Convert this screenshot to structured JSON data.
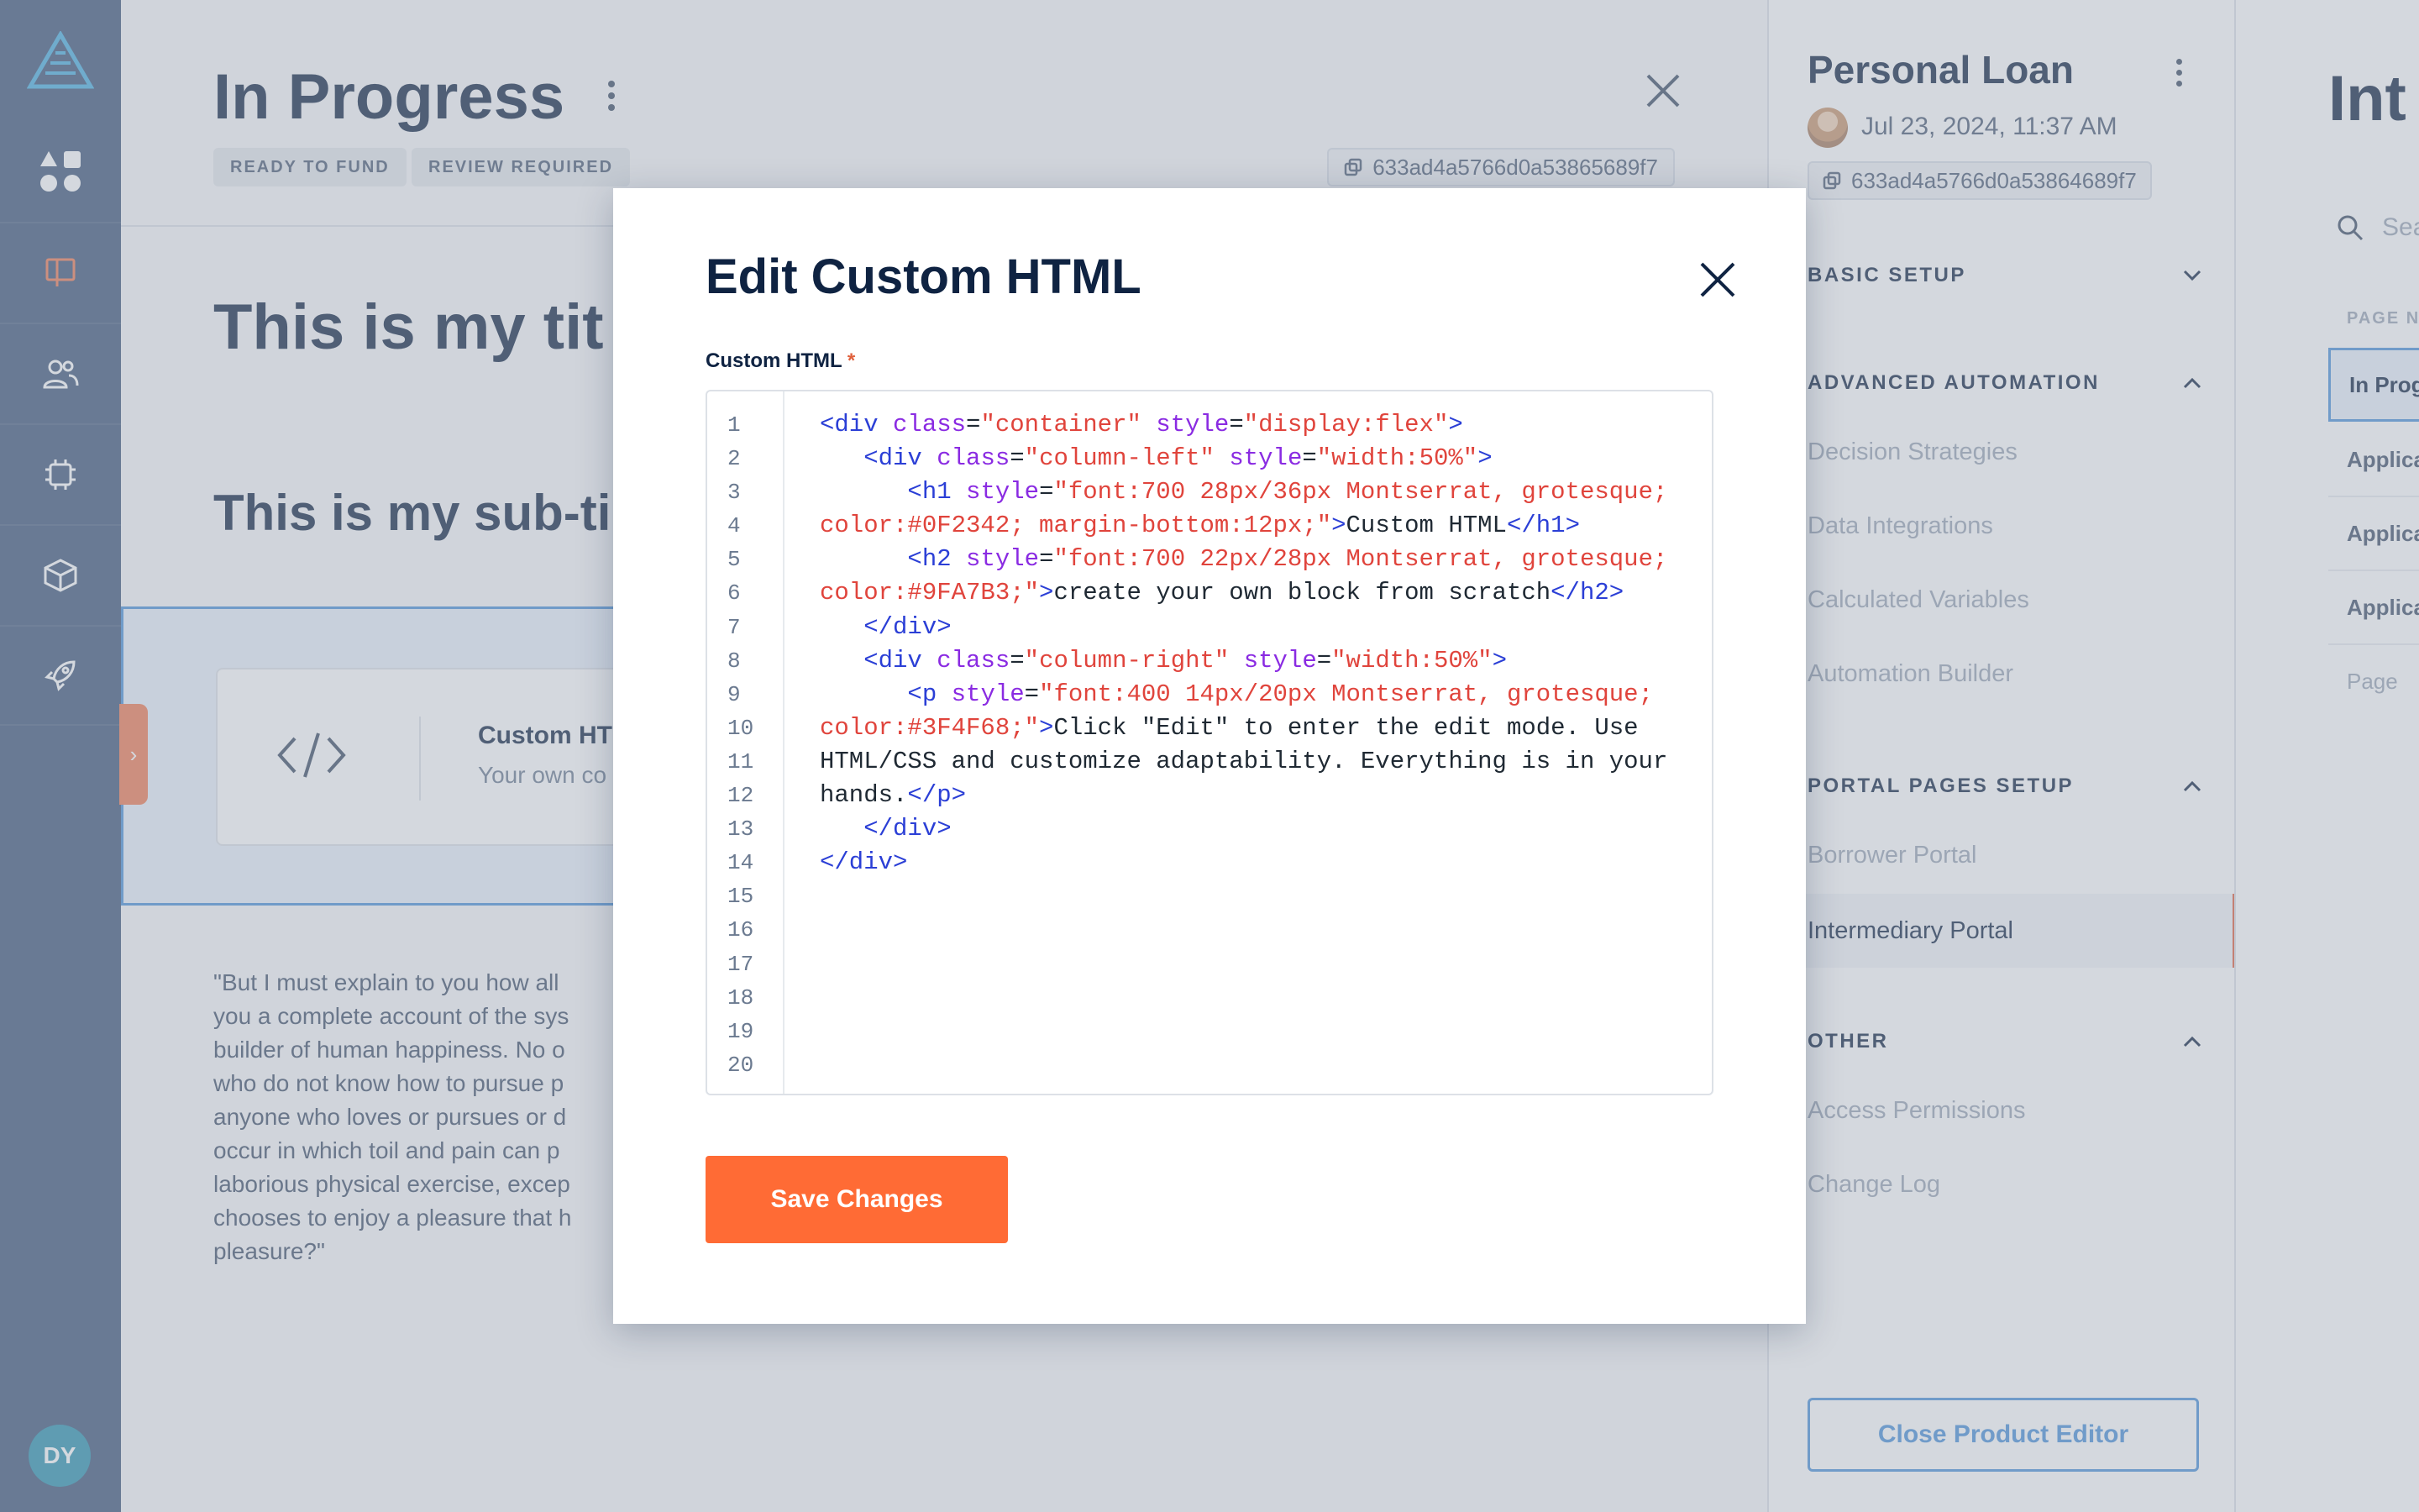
{
  "rail": {
    "avatar_initials": "DY",
    "active_color": "#f07a52"
  },
  "main": {
    "title": "In Progress",
    "tags": [
      "READY TO FUND",
      "REVIEW REQUIRED"
    ],
    "record_id": "633ad4a5766d0a53865689f7",
    "heading_1": "This is my tit",
    "heading_2": "This is my sub-ti",
    "block": {
      "title": "Custom HT",
      "description": "Your own co"
    },
    "paragraph_lines": [
      "\"But I must explain to you how all",
      "you a complete account of the sys",
      "builder of human happiness. No o",
      "who do not know how to pursue p",
      "anyone who loves or pursues or d",
      "occur in which toil and pain can p",
      "laborious physical exercise, excep",
      "chooses to enjoy a pleasure that h",
      "pleasure?\""
    ]
  },
  "sidebar": {
    "title": "Personal Loan",
    "date": "Jul 23, 2024, 11:37 AM",
    "product_id": "633ad4a5766d0a53864689f7",
    "sections": [
      {
        "label": "BASIC SETUP",
        "expanded": false,
        "items": []
      },
      {
        "label": "ADVANCED AUTOMATION",
        "expanded": true,
        "items": [
          "Decision Strategies",
          "Data Integrations",
          "Calculated Variables",
          "Automation Builder"
        ]
      },
      {
        "label": "PORTAL PAGES SETUP",
        "expanded": true,
        "items": [
          "Borrower Portal",
          "Intermediary Portal"
        ]
      },
      {
        "label": "OTHER",
        "expanded": true,
        "items": [
          "Access Permissions",
          "Change Log"
        ]
      }
    ],
    "active_item": "Intermediary Portal",
    "close_button": "Close Product Editor"
  },
  "far_panel": {
    "title": "Int",
    "search_placeholder": "Sea",
    "column_header": "PAGE NA",
    "rows": [
      "In Prog",
      "Applica",
      "Applica",
      "Applica"
    ],
    "footer": "Page"
  },
  "modal": {
    "title": "Edit Custom HTML",
    "field_label": "Custom HTML",
    "required_mark": "*",
    "line_numbers": [
      "1",
      "2",
      "3",
      "4",
      "5",
      "6",
      "7",
      "8",
      "9",
      "10",
      "11",
      "12",
      "13",
      "14",
      "15",
      "16",
      "17",
      "18",
      "19",
      "20"
    ],
    "code_lines": [
      "<div class=\"container\" style=\"display:flex\">",
      "   <div class=\"column-left\" style=\"width:50%\">",
      "      <h1 style=\"font:700 28px/36px Montserrat, grotesque;",
      "color:#0F2342; margin-bottom:12px;\">Custom HTML</h1>",
      "      <h2 style=\"font:700 22px/28px Montserrat, grotesque;",
      "color:#9FA7B3;\">create your own block from scratch</h2>",
      "   </div>",
      "   <div class=\"column-right\" style=\"width:50%\">",
      "      <p style=\"font:400 14px/20px Montserrat, grotesque;",
      "color:#3F4F68;\">Click \"Edit\" to enter the edit mode. Use",
      "HTML/CSS and customize adaptability. Everything is in your",
      "hands.</p>",
      "   </div>",
      "</div>",
      "",
      "",
      "",
      "",
      "",
      ""
    ],
    "save_button": "Save Changes",
    "accent_color": "#ff6b35"
  }
}
